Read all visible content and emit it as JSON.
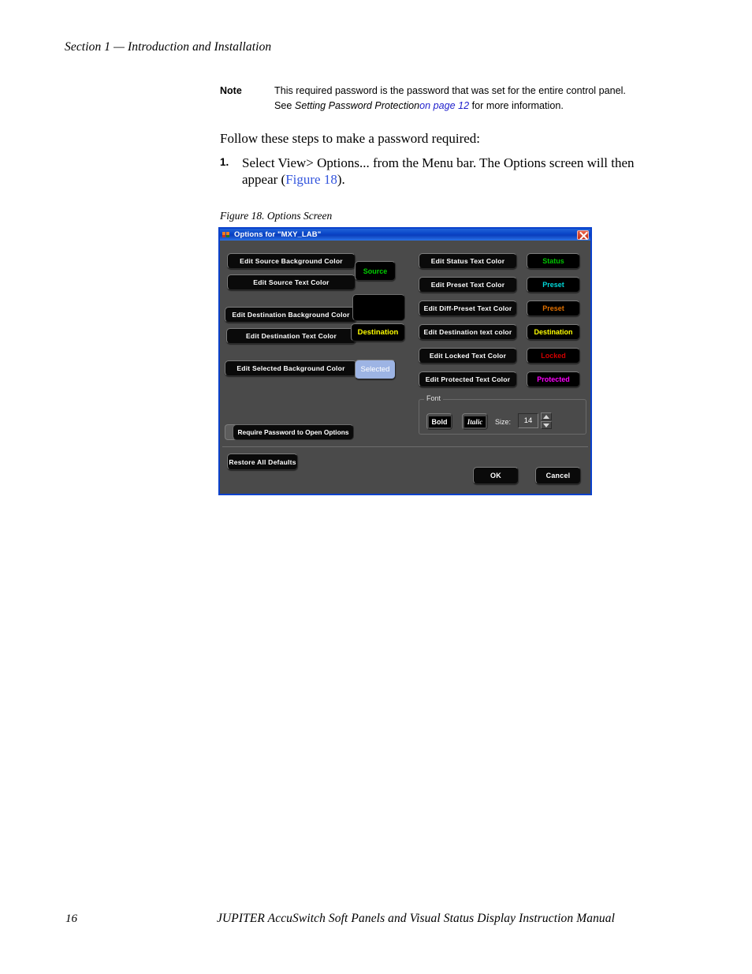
{
  "page": {
    "section_header": "Section 1 — Introduction and Installation",
    "footer_page_number": "16",
    "footer_title": "JUPITER AccuSwitch Soft Panels and Visual Status Display Instruction Manual"
  },
  "note": {
    "label": "Note",
    "line1": "This required password is the password that was set for the entire control",
    "line2_pre": "panel. See ",
    "line2_italic": "Setting Password Protection",
    "line2_link": "on page 12",
    "line2_post": " for more information."
  },
  "body": {
    "intro": "Follow these steps to make a password required:",
    "step_number": "1.",
    "step_text_pre": "Select View> Options... from the Menu bar. The Options screen will then appear (",
    "step_link": "Figure 18",
    "step_text_post": ")."
  },
  "figure": {
    "caption": "Figure 18.  Options Screen"
  },
  "dialog": {
    "title": "Options for \"MXY_LAB\"",
    "window_icon": "app-palette-icon",
    "close_icon": "close-icon",
    "left_buttons": [
      {
        "label": "Edit Source Background Color"
      },
      {
        "label": "Edit Source Text Color"
      },
      {
        "label": "Edit Destination Background Color"
      },
      {
        "label": "Edit Destination Text Color"
      },
      {
        "label": "Edit Selected Background Color"
      }
    ],
    "left_swatches": [
      {
        "name": "source-swatch",
        "label": "Source",
        "color": "#00d000",
        "bg": "#000000"
      },
      {
        "name": "destination-swatch",
        "label": "Destination",
        "color": "#ffff00",
        "bg": "#000000"
      },
      {
        "name": "selected-swatch",
        "label": "Selected",
        "color": "#ffffff",
        "bg": "#9db4e4"
      }
    ],
    "right_buttons": [
      {
        "label": "Edit Status Text Color"
      },
      {
        "label": "Edit Preset Text Color"
      },
      {
        "label": "Edit Diff-Preset Text Color"
      },
      {
        "label": "Edit Destination text color"
      },
      {
        "label": "Edit Locked Text Color"
      },
      {
        "label": "Edit Protected Text Color"
      }
    ],
    "right_swatches": [
      {
        "name": "status-swatch",
        "label": "Status",
        "color": "#00c400"
      },
      {
        "name": "preset-swatch",
        "label": "Preset",
        "color": "#00d8d8"
      },
      {
        "name": "diff-preset-swatch",
        "label": "Preset",
        "color": "#e07000"
      },
      {
        "name": "destination-text-swatch",
        "label": "Destination",
        "color": "#ffff00"
      },
      {
        "name": "locked-swatch",
        "label": "Locked",
        "color": "#d00000"
      },
      {
        "name": "protected-swatch",
        "label": "Protected",
        "color": "#ff00ff"
      }
    ],
    "font_group": {
      "legend": "Font",
      "bold_label": "Bold",
      "italic_label": "Italic",
      "size_label": "Size:",
      "size_value": "14"
    },
    "require_password_label": "Require Password to Open Options",
    "restore_label": "Restore All Defaults",
    "ok_label": "OK",
    "cancel_label": "Cancel"
  }
}
